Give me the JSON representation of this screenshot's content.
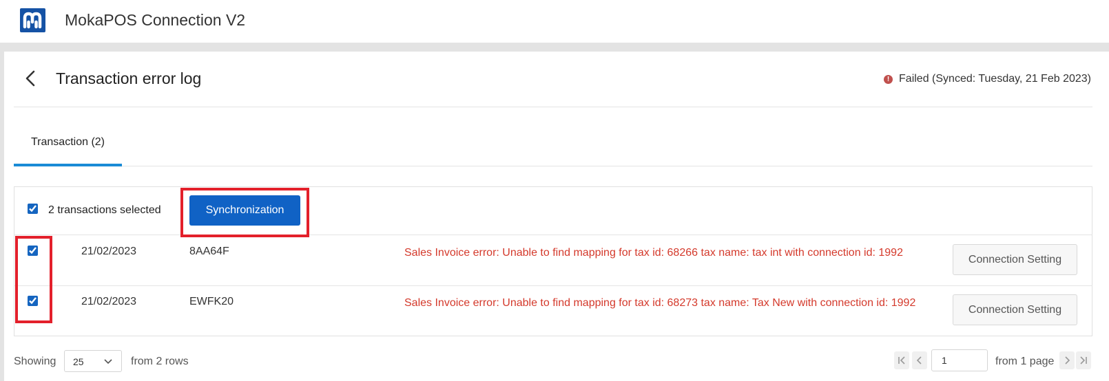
{
  "app": {
    "title": "MokaPOS Connection V2",
    "logo_icon": "moka-logo"
  },
  "header": {
    "title": "Transaction error log",
    "status_text": "Failed (Synced: Tuesday, 21 Feb 2023)",
    "status_icon": "warning-icon"
  },
  "tabs": [
    {
      "label": "Transaction (2)",
      "active": true
    }
  ],
  "bulk": {
    "checked": true,
    "selected_label": "2 transactions selected",
    "sync_label": "Synchronization"
  },
  "rows": [
    {
      "checked": true,
      "date": "21/02/2023",
      "code": "8AA64F",
      "error": "Sales Invoice error: Unable to find mapping for tax id: 68266 tax name: tax int with connection id: 1992",
      "action_label": "Connection Setting"
    },
    {
      "checked": true,
      "date": "21/02/2023",
      "code": "EWFK20",
      "error": "Sales Invoice error: Unable to find mapping for tax id: 68273 tax name: Tax New with connection id: 1992",
      "action_label": "Connection Setting"
    }
  ],
  "footer": {
    "showing_label": "Showing",
    "page_size": "25",
    "rows_text": "from 2 rows",
    "page_value": "1",
    "pages_text": "from 1 page"
  },
  "colors": {
    "primary": "#1062c5",
    "error": "#d4392b",
    "tab_indicator": "#1a8bd6",
    "highlight": "#e3202b"
  }
}
